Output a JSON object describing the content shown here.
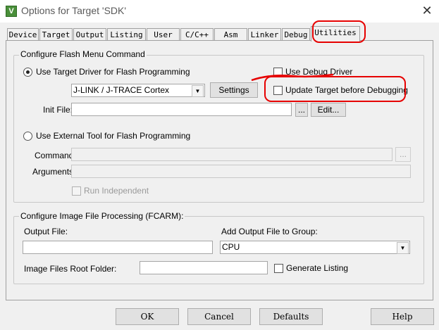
{
  "window": {
    "title": "Options for Target 'SDK'",
    "close_glyph": "✕",
    "app_icon_glyph": "V"
  },
  "tabs": [
    {
      "label": "Device"
    },
    {
      "label": "Target"
    },
    {
      "label": "Output"
    },
    {
      "label": "Listing"
    },
    {
      "label": "User"
    },
    {
      "label": "C/C++"
    },
    {
      "label": "Asm"
    },
    {
      "label": "Linker"
    },
    {
      "label": "Debug"
    },
    {
      "label": "Utilities",
      "active": true
    }
  ],
  "flash": {
    "group_title": "Configure Flash Menu Command",
    "use_target_driver_label": "Use Target Driver for Flash Programming",
    "use_target_driver_selected": true,
    "driver_value": "J-LINK / J-TRACE Cortex",
    "settings_label": "Settings",
    "use_debug_driver_label": "Use Debug Driver",
    "use_debug_driver_checked": false,
    "update_target_label": "Update Target before Debugging",
    "update_target_checked": false,
    "init_file_label": "Init File:",
    "init_file_value": "",
    "browse_label": "...",
    "edit_label": "Edit...",
    "use_external_tool_label": "Use External Tool for Flash Programming",
    "use_external_tool_selected": false,
    "command_label": "Command:",
    "command_value": "",
    "arguments_label": "Arguments:",
    "arguments_value": "",
    "run_independent_label": "Run Independent",
    "run_independent_checked": false
  },
  "image": {
    "group_title": "Configure Image File Processing (FCARM):",
    "output_file_label": "Output File:",
    "output_file_value": "",
    "add_output_label": "Add Output File  to Group:",
    "group_value": "CPU",
    "root_folder_label": "Image Files Root Folder:",
    "root_folder_value": "",
    "generate_listing_label": "Generate Listing",
    "generate_listing_checked": false
  },
  "footer": {
    "ok": "OK",
    "cancel": "Cancel",
    "defaults": "Defaults",
    "help": "Help"
  },
  "colors": {
    "annotation": "#e60000",
    "window_bg": "#f0f0f0"
  }
}
